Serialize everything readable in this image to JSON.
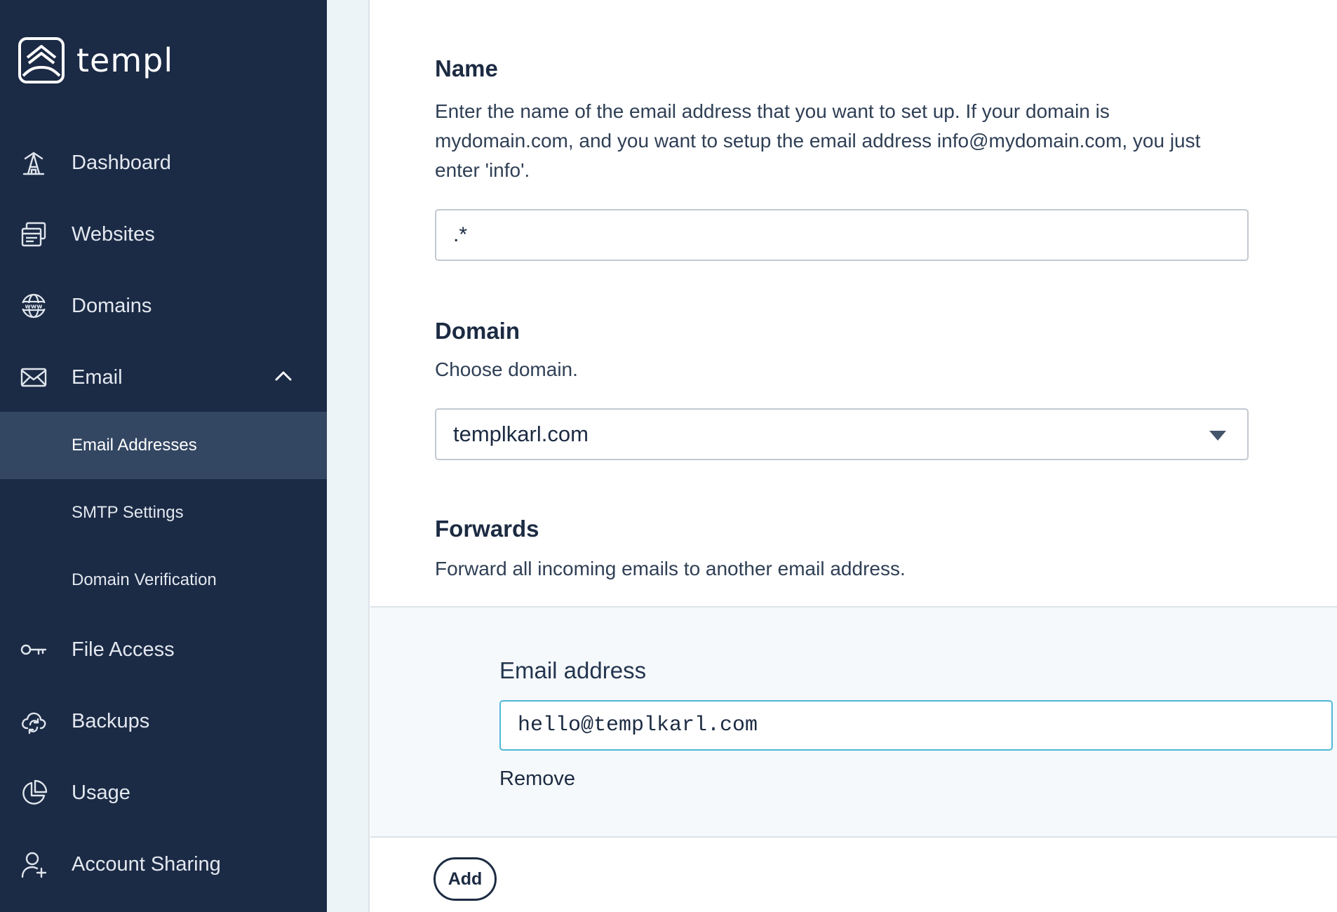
{
  "brand": {
    "name": "templ",
    "logo_icon": "templ-logo-icon"
  },
  "sidebar": {
    "items": [
      {
        "label": "Dashboard",
        "icon": "dashboard-icon"
      },
      {
        "label": "Websites",
        "icon": "websites-icon"
      },
      {
        "label": "Domains",
        "icon": "globe-www-icon"
      },
      {
        "label": "Email",
        "icon": "envelope-icon",
        "expanded": true
      },
      {
        "label": "File Access",
        "icon": "key-icon"
      },
      {
        "label": "Backups",
        "icon": "cloud-sync-icon"
      },
      {
        "label": "Usage",
        "icon": "pie-chart-icon"
      },
      {
        "label": "Account Sharing",
        "icon": "user-add-icon"
      }
    ],
    "email_sub": [
      {
        "label": "Email Addresses",
        "active": true
      },
      {
        "label": "SMTP Settings",
        "active": false
      },
      {
        "label": "Domain Verification",
        "active": false
      }
    ]
  },
  "form": {
    "name": {
      "title": "Name",
      "description": "Enter the name of the email address that you want to set up. If your domain is mydomain.com, and you want to setup the email address info@mydomain.com, you just enter 'info'.",
      "value": ".*"
    },
    "domain": {
      "title": "Domain",
      "description": "Choose domain.",
      "selected": "templkarl.com"
    },
    "forwards": {
      "title": "Forwards",
      "description": "Forward all incoming emails to another email address.",
      "entry_label": "Email address",
      "entry_value": "hello@templkarl.com",
      "remove_label": "Remove",
      "add_label": "Add"
    }
  },
  "colors": {
    "sidebar_bg": "#1b2a45",
    "sidebar_active": "#334662",
    "text_dark": "#1c2b42",
    "input_focus": "#4fb8d6"
  }
}
